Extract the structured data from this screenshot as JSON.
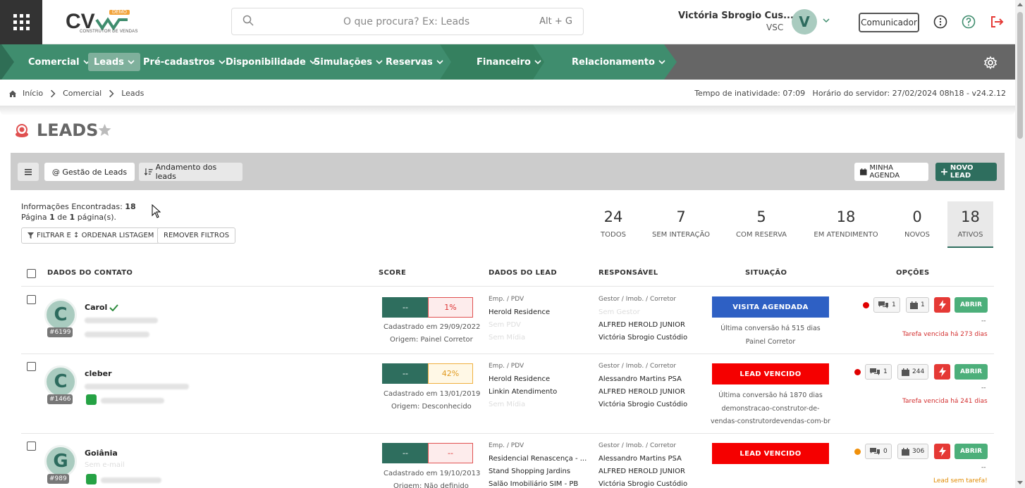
{
  "app": {
    "logo_text": "CV",
    "logo_demo": "DEMO",
    "logo_sub": "CONSTRUTOR DE VENDAS"
  },
  "search": {
    "placeholder": "O que procura? Ex: Leads",
    "shortcut": "Alt + G"
  },
  "user": {
    "name": "Victória Sbrogio Cus...",
    "code": "VSC",
    "initial": "V"
  },
  "topbar": {
    "communicator": "Comunicador"
  },
  "nav": {
    "items": [
      {
        "label": "Comercial"
      },
      {
        "label": "Leads"
      },
      {
        "label": "Pré-cadastros"
      },
      {
        "label": "Disponibilidade"
      },
      {
        "label": "Simulações"
      },
      {
        "label": "Reservas"
      },
      {
        "label": "Financeiro"
      },
      {
        "label": "Relacionamento"
      }
    ]
  },
  "breadcrumb": {
    "home": "Início",
    "section": "Comercial",
    "page": "Leads"
  },
  "server_info": "Tempo de inatividade: 07:09   Horário do servidor: 27/02/2024 08h18 - v24.2.12",
  "page_title": "LEADS",
  "toolbar": {
    "gestao": "@ Gestão de Leads",
    "andamento": "Andamento dos leads",
    "agenda": "MINHA AGENDA",
    "novo": "NOVO LEAD"
  },
  "info": {
    "found_label": "Informações Encontradas:",
    "found_count": "18",
    "page_text_a": "Página",
    "page_current": "1",
    "page_text_b": "de",
    "page_total": "1",
    "page_text_c": "página(s).",
    "filter_btn": "FILTRAR E ↕ ORDENAR LISTAGEM",
    "remove_btn": "REMOVER FILTROS"
  },
  "stats": [
    {
      "num": "24",
      "label": "TODOS"
    },
    {
      "num": "7",
      "label": "SEM INTERAÇÃO"
    },
    {
      "num": "5",
      "label": "COM RESERVA"
    },
    {
      "num": "18",
      "label": "EM ATENDIMENTO"
    },
    {
      "num": "0",
      "label": "NOVOS"
    },
    {
      "num": "18",
      "label": "ATIVOS"
    }
  ],
  "table": {
    "headers": {
      "contact": "DADOS DO CONTATO",
      "score": "SCORE",
      "lead": "DADOS DO LEAD",
      "responsible": "RESPONSÁVEL",
      "situation": "SITUAÇÃO",
      "options": "OPÇÕES"
    },
    "rows": [
      {
        "initial": "C",
        "id": "#6199",
        "name": "Carol",
        "score_a": "--",
        "score_b": "1%",
        "created": "Cadastrado em 29/09/2022",
        "origin": "Origem: Painel Corretor",
        "lead_label": "Emp. / PDV",
        "lead_1": "Herold Residence",
        "lead_2": "Sem PDV",
        "lead_3": "Sem Mídia",
        "resp_label": "Gestor / Imob. / Corretor",
        "resp_1": "Sem Gestor",
        "resp_2": "ALFRED HEROLD JUNIOR",
        "resp_3": "Victória Sbrogio Custódio",
        "situation": "VISITA AGENDADA",
        "sit_1": "Última conversão há 515 dias",
        "sit_2": "Painel Corretor",
        "msgs": "1",
        "tasks": "1",
        "open": "ABRIR",
        "dash": "--",
        "task_note": "Tarefa vencida há 273 dias"
      },
      {
        "initial": "C",
        "id": "#1466",
        "name": "cleber",
        "score_a": "--",
        "score_b": "42%",
        "created": "Cadastrado em 13/01/2019",
        "origin": "Origem: Desconhecido",
        "lead_label": "Emp. / PDV",
        "lead_1": "Herold Residence",
        "lead_2": "Linkin Atendimento",
        "lead_3": "Sem Mídia",
        "resp_label": "Gestor / Imob. / Corretor",
        "resp_1": "Alessandro Martins PSA",
        "resp_2": "ALFRED HEROLD JUNIOR",
        "resp_3": "Victória Sbrogio Custódio",
        "situation": "LEAD VENCIDO",
        "sit_1": "Última conversão há 1870 dias",
        "sit_2": "demonstracao-construtor-de-",
        "sit_3": "vendas-construtordevendas-com-br",
        "msgs": "1",
        "tasks": "244",
        "open": "ABRIR",
        "dash": "--",
        "task_note": "Tarefa vencida há 241 dias"
      },
      {
        "initial": "G",
        "id": "#989",
        "name": "Goiânia",
        "email": "Sem e-mail",
        "score_a": "--",
        "score_b": "--",
        "created": "Cadastrado em 19/10/2013",
        "origin": "Origem: Não definido",
        "lead_label": "Emp. / PDV",
        "lead_1": "Residencial Renascença - ...",
        "lead_2": "Stand Shopping Jardins",
        "lead_3": "Salão Imobiliário SIM - PB",
        "resp_label": "Gestor / Imob. / Corretor",
        "resp_1": "Alessandro Martins PSA",
        "resp_2": "ALFRED HEROLD JUNIOR",
        "resp_3": "Victória Sbrogio Custódio",
        "situation": "LEAD VENCIDO",
        "msgs": "0",
        "tasks": "306",
        "open": "ABRIR",
        "dash": "--",
        "task_note": "Lead sem tarefa!"
      }
    ]
  },
  "colors": {
    "primary_green": "#3f8d6e",
    "dark_green": "#2e6e5e",
    "blue_status": "#2e60c4",
    "red_status": "#f50000"
  }
}
